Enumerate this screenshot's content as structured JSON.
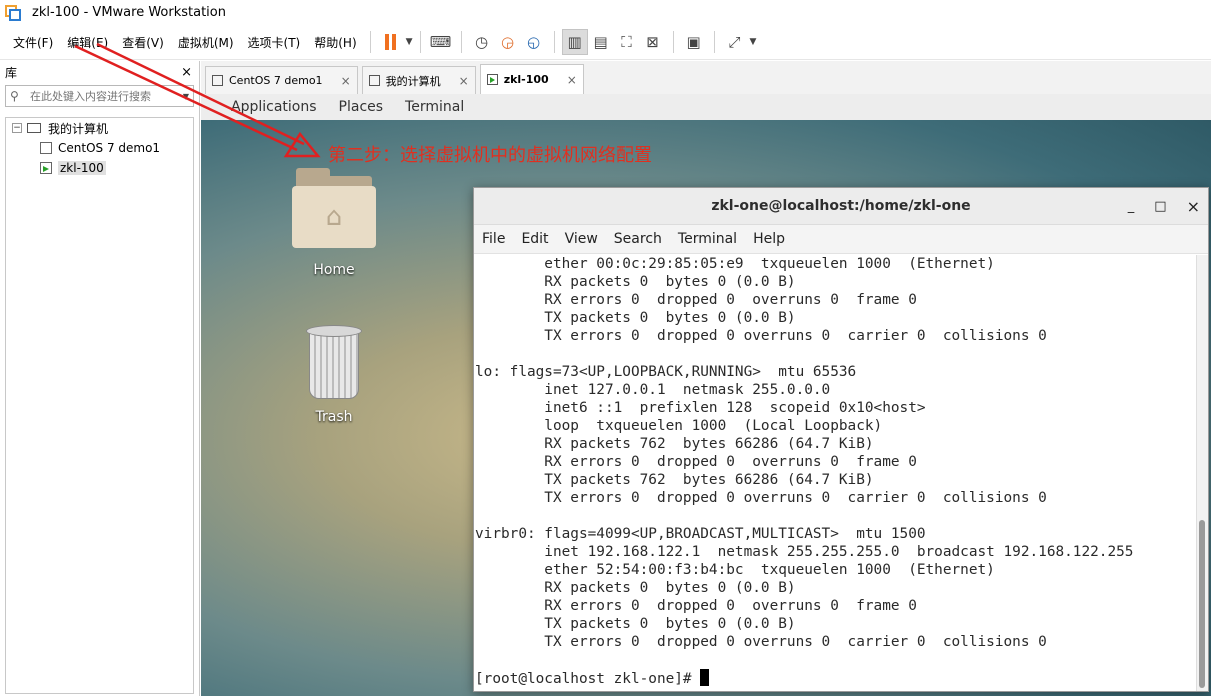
{
  "window": {
    "title": "zkl-100 - VMware Workstation"
  },
  "menu": [
    "文件(F)",
    "编辑(E)",
    "查看(V)",
    "虚拟机(M)",
    "选项卡(T)",
    "帮助(H)"
  ],
  "library": {
    "title": "库",
    "close": "×",
    "search_placeholder": "在此处键入内容进行搜索",
    "tree": {
      "root": "我的计算机",
      "items": [
        "CentOS 7 demo1",
        "zkl-100"
      ]
    }
  },
  "tabs": [
    {
      "label": "CentOS 7 demo1",
      "close": "×"
    },
    {
      "label": "我的计算机",
      "close": "×"
    },
    {
      "label": "zkl-100",
      "close": "×"
    }
  ],
  "guest_topbar": [
    "Applications",
    "Places",
    "Terminal"
  ],
  "desktop": {
    "icons": [
      "Home",
      "Trash"
    ],
    "annotation": "第二步：选择虚拟机中的虚拟机网络配置"
  },
  "terminal": {
    "title": "zkl-one@localhost:/home/zkl-one",
    "controls": {
      "minimize": "_",
      "maximize": "□",
      "close": "×"
    },
    "menu": [
      "File",
      "Edit",
      "View",
      "Search",
      "Terminal",
      "Help"
    ],
    "lines": [
      "        ether 00:0c:29:85:05:e9  txqueuelen 1000  (Ethernet)",
      "        RX packets 0  bytes 0 (0.0 B)",
      "        RX errors 0  dropped 0  overruns 0  frame 0",
      "        TX packets 0  bytes 0 (0.0 B)",
      "        TX errors 0  dropped 0 overruns 0  carrier 0  collisions 0",
      "",
      "lo: flags=73<UP,LOOPBACK,RUNNING>  mtu 65536",
      "        inet 127.0.0.1  netmask 255.0.0.0",
      "        inet6 ::1  prefixlen 128  scopeid 0x10<host>",
      "        loop  txqueuelen 1000  (Local Loopback)",
      "        RX packets 762  bytes 66286 (64.7 KiB)",
      "        RX errors 0  dropped 0  overruns 0  frame 0",
      "        TX packets 762  bytes 66286 (64.7 KiB)",
      "        TX errors 0  dropped 0 overruns 0  carrier 0  collisions 0",
      "",
      "virbr0: flags=4099<UP,BROADCAST,MULTICAST>  mtu 1500",
      "        inet 192.168.122.1  netmask 255.255.255.0  broadcast 192.168.122.255",
      "        ether 52:54:00:f3:b4:bc  txqueuelen 1000  (Ethernet)",
      "        RX packets 0  bytes 0 (0.0 B)",
      "        RX errors 0  dropped 0  overruns 0  frame 0",
      "        TX packets 0  bytes 0 (0.0 B)",
      "        TX errors 0  dropped 0 overruns 0  carrier 0  collisions 0",
      ""
    ],
    "prompt": "[root@localhost zkl-one]# "
  },
  "colors": {
    "annotation": "#e03020",
    "pause": "#f07020",
    "running": "#2aa02a"
  }
}
